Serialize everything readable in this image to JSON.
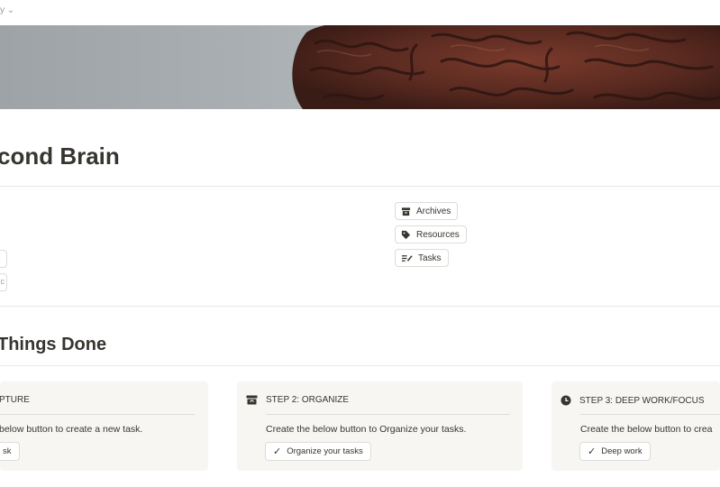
{
  "breadcrumb": {
    "text": "y ⌄"
  },
  "page": {
    "title": "cond Brain"
  },
  "links": [
    {
      "label": "Archives",
      "icon": "archive-icon"
    },
    {
      "label": "Resources",
      "icon": "tag-icon"
    },
    {
      "label": "Tasks",
      "icon": "checklist-icon"
    }
  ],
  "left_stub": {
    "text": "c"
  },
  "section": {
    "heading": "Things Done"
  },
  "cards": [
    {
      "step": "PTURE",
      "description": "below button to create a new task.",
      "button": "sk"
    },
    {
      "step": "STEP 2: ORGANIZE",
      "description": "Create the below button to Organize your tasks.",
      "button": "Organize your tasks",
      "icon": "inbox-stack-icon"
    },
    {
      "step": "STEP 3: DEEP WORK/FOCUS",
      "description": "Create the below button to crea",
      "button": "Deep work",
      "icon": "clock-icon"
    }
  ],
  "colors": {
    "text": "#37352f",
    "card_bg": "#f7f6f3",
    "border": "#dcdcd8"
  }
}
